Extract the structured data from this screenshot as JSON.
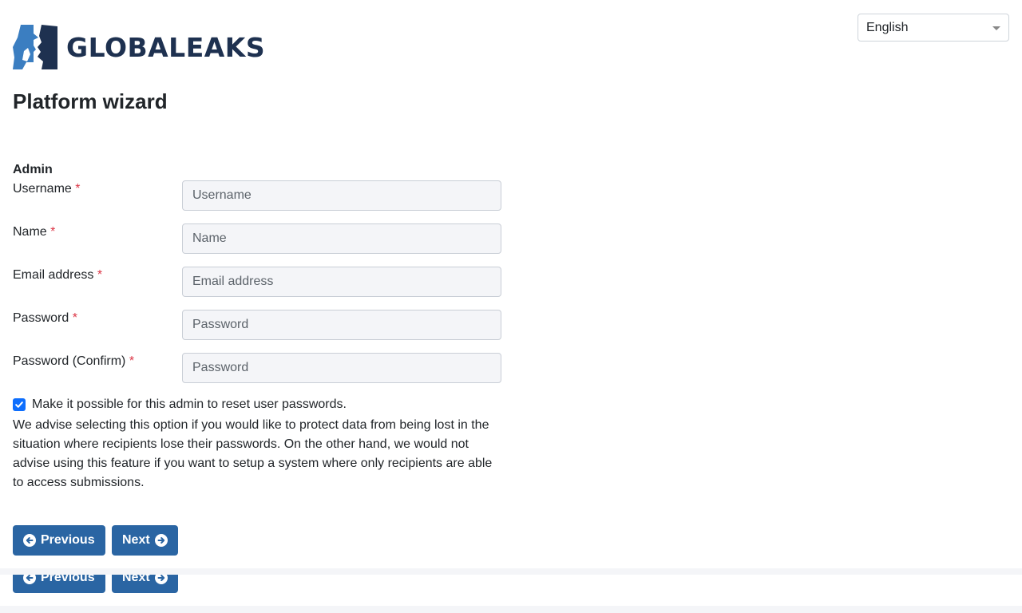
{
  "header": {
    "logo_text": "GLOBALEAKS",
    "language": {
      "selected": "English"
    }
  },
  "page": {
    "title": "Platform wizard"
  },
  "form": {
    "section_label": "Admin",
    "fields": [
      {
        "label": "Username",
        "required_mark": "*",
        "placeholder": "Username",
        "value": ""
      },
      {
        "label": "Name",
        "required_mark": "*",
        "placeholder": "Name",
        "value": ""
      },
      {
        "label": "Email address",
        "required_mark": "*",
        "placeholder": "Email address",
        "value": ""
      },
      {
        "label": "Password",
        "required_mark": "*",
        "placeholder": "Password",
        "value": ""
      },
      {
        "label": "Password (Confirm)",
        "required_mark": "*",
        "placeholder": "Password",
        "value": ""
      }
    ],
    "reset_option": {
      "label": "Make it possible for this admin to reset user passwords.",
      "checked": true,
      "help": "We advise selecting this option if you would like to protect data from being lost in the situation where recipients lose their passwords. On the other hand, we would not advise using this feature if you want to setup a system where only recipients are able to access submissions."
    }
  },
  "buttons": {
    "previous_label": "Previous",
    "next_label": "Next"
  },
  "colors": {
    "primary_button": "#2a65a3",
    "checkbox": "#0d6efd",
    "required": "#dc3545",
    "logo_text": "#1e3150",
    "logo_light": "#3b7ec1",
    "logo_dark": "#1e3150"
  },
  "icons": [
    "logo-mark-icon",
    "chevron-down-icon",
    "arrow-left-circle-icon",
    "arrow-right-circle-icon",
    "checkmark-icon"
  ]
}
